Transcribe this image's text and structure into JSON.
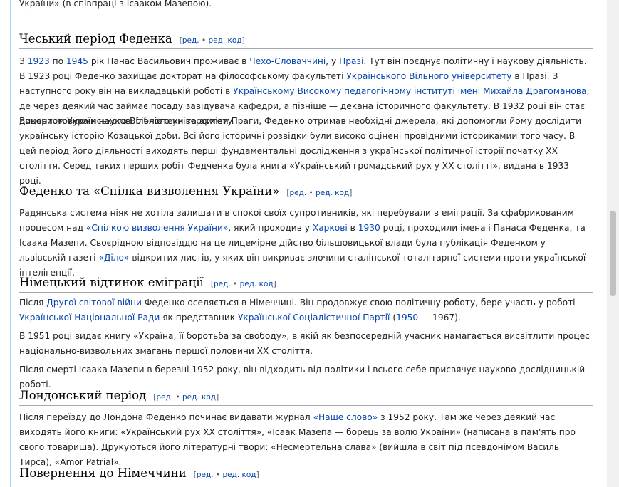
{
  "top_fragment": "України» (в співпраці з Ісааком Мазепою).",
  "edit_links": {
    "open": "[",
    "edit": "ред.",
    "dot": " • ",
    "edit_code": "ред. код",
    "close": "]"
  },
  "sections": {
    "czech": {
      "title": "Чеський період Феденка",
      "p1": [
        {
          "t": "З "
        },
        {
          "t": "1923",
          "link": true
        },
        {
          "t": " по "
        },
        {
          "t": "1945",
          "link": true
        },
        {
          "t": " рік Панас Васильович проживає в "
        },
        {
          "t": "Чехо-Словаччині",
          "link": true
        },
        {
          "t": ", у "
        },
        {
          "t": "Празі",
          "link": true
        },
        {
          "t": ". Тут він поєднує політичну і наукову діяльність. В 1923 році Феденко захищає докторат на філософському факультеті "
        },
        {
          "t": "Українського Вільного університету",
          "link": true
        },
        {
          "t": " в Празі. З наступного року він на викладацькій роботі в "
        },
        {
          "t": "Українському Високому педагогічному інституті імені Михайла Драгоманова",
          "link": true
        },
        {
          "t": ", де через деякий час займає посаду завідувача кафедри, а пізніше — декана історичного факультету. В 1932 році він стає доцентом Українського Вільного університету."
        }
      ],
      "p2": "Використовуючи наукові бібліотеки та архіви Праги, Феденко отримав необхідні джерела, які допомогли йому дослідити українську історію Козацької доби. Всі його історичні розвідки були високо оцінені провідними історикамии того часу. В цей період його діяльності виходять перші фундаментальні дослідження з української політичної історії початку XX століття. Серед таких перших робіт Федченка була книга «Український громадський рух у XX столітті», видана в 1933 році."
    },
    "union": {
      "title": "Феденко та «Спілка визволення України»",
      "p1": [
        {
          "t": "Радянська система ніяк не хотіла залишати в спокої своїх супротивників, які перебували в еміграції. За сфабрикованим процесом над "
        },
        {
          "t": "«Спілкою визволення України»",
          "link": true
        },
        {
          "t": ", який проходив у "
        },
        {
          "t": "Харкові",
          "link": true
        },
        {
          "t": " в "
        },
        {
          "t": "1930",
          "link": true
        },
        {
          "t": " році, проходили імена і Панаса Феденка, та Ісаака Мазепи. Своєрідною відповіддю на це лицемірне дійство більшовицької влади була публікація Феденком у львівській газеті "
        },
        {
          "t": "«Діло»",
          "link": true
        },
        {
          "t": " відкритих листів, у яких він викриває злочини сталінської тоталітарної системи проти української інтелігенції."
        }
      ]
    },
    "german": {
      "title": "Німецький відтинок еміграції",
      "p1": [
        {
          "t": "Після "
        },
        {
          "t": "Другої світової війни",
          "link": true
        },
        {
          "t": " Феденко оселяється в Німеччині. Він продовжує свою політичну роботу, бере участь у роботі "
        },
        {
          "t": "Української Національної Ради",
          "link": true
        },
        {
          "t": " як представник "
        },
        {
          "t": "Української Соціалістичної Партії",
          "link": true
        },
        {
          "t": " ("
        },
        {
          "t": "1950",
          "link": true
        },
        {
          "t": " — 1967)."
        }
      ],
      "p2": "В 1951 році видає книгу «Україна, її боротьба за свободу», в якій як безпосередній учасник намагається висвітлити процес національно-визвольних змагань першої половини XX століття.",
      "p3": "Після смерті Ісаака Мазепи в березні 1952 року, він відходить від політики і всього себе присвячує науково-дослідницькій роботі."
    },
    "london": {
      "title": "Лондонський період",
      "p1": [
        {
          "t": "Після переїзду до Лондона Феденко починає видавати журнал "
        },
        {
          "t": "«Наше слово»",
          "link": true
        },
        {
          "t": " з 1952 року. Там же через деякий час виходять його книги: «Український рух XX століття», «Ісаак Мазепа — борець за волю України» (написана в пам'ять про свого товариша). Друкуються його літературні твори: «Несмертельна слава» (вийшла в світ під псевдонімом Василь Тирса), «Amor Patrial»."
        }
      ]
    },
    "return": {
      "title": "Повернення до Німеччини"
    }
  }
}
